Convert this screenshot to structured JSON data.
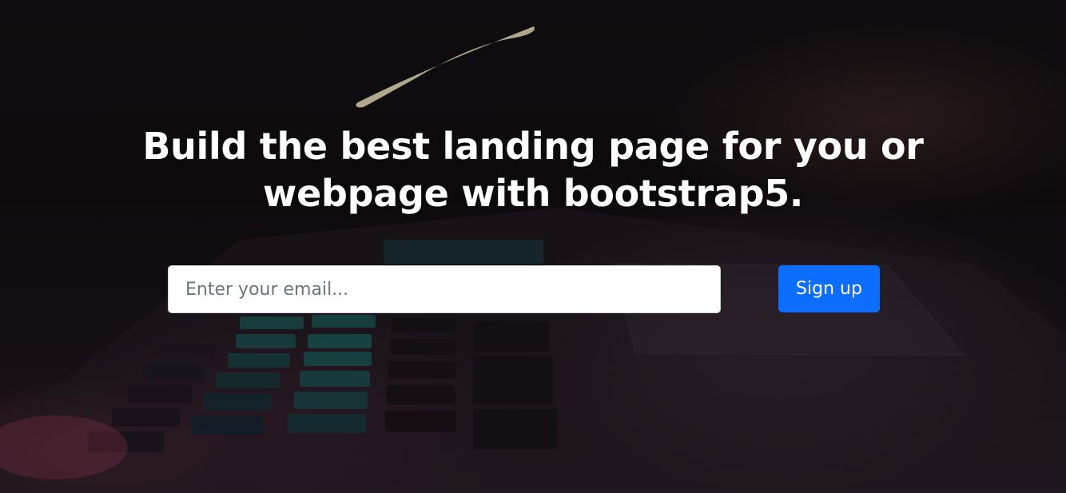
{
  "hero": {
    "headline": "Build the best landing page for you or webpage with bootstrap5.",
    "email_placeholder": "Enter your email...",
    "email_value": "",
    "signup_label": "Sign up",
    "background_image": "laptop-keyboard-dark-photo"
  },
  "colors": {
    "button_primary": "#0d6efd",
    "headline_text": "#ffffff",
    "input_background": "#ffffff",
    "placeholder_text": "#6c757d"
  }
}
